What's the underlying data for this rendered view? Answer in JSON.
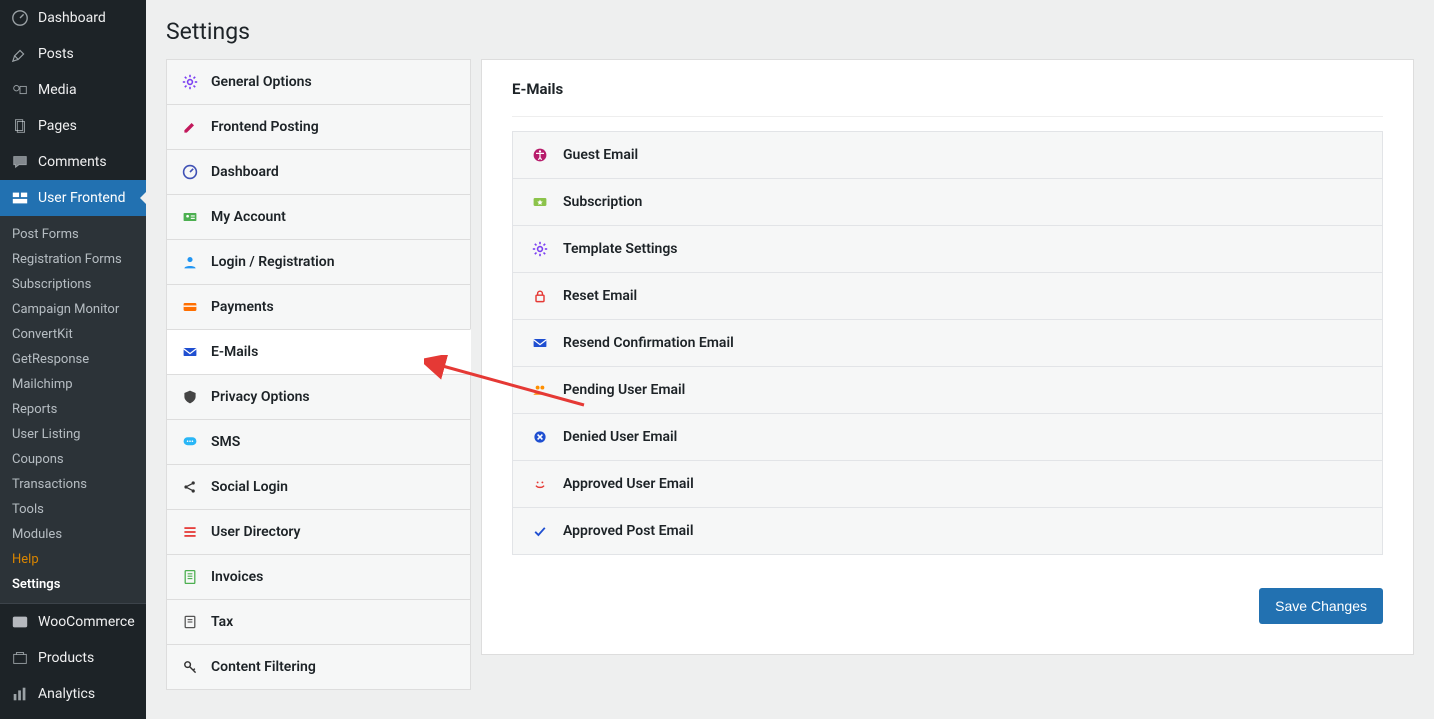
{
  "page_title": "Settings",
  "wp_sidebar": {
    "top": [
      {
        "label": "Dashboard",
        "icon": "dashboard"
      },
      {
        "label": "Posts",
        "icon": "pin"
      },
      {
        "label": "Media",
        "icon": "media"
      },
      {
        "label": "Pages",
        "icon": "page"
      },
      {
        "label": "Comments",
        "icon": "comment"
      }
    ],
    "active": {
      "label": "User Frontend",
      "icon": "uf"
    },
    "sub": [
      "Post Forms",
      "Registration Forms",
      "Subscriptions",
      "Campaign Monitor",
      "ConvertKit",
      "GetResponse",
      "Mailchimp",
      "Reports",
      "User Listing",
      "Coupons",
      "Transactions",
      "Tools",
      "Modules"
    ],
    "sub_help": "Help",
    "sub_settings": "Settings",
    "bottom": [
      {
        "label": "WooCommerce",
        "icon": "woo"
      },
      {
        "label": "Products",
        "icon": "products"
      },
      {
        "label": "Analytics",
        "icon": "analytics"
      }
    ]
  },
  "settings_tabs": [
    {
      "label": "General Options",
      "icon": "gear",
      "color": "#7b3ff2"
    },
    {
      "label": "Frontend Posting",
      "icon": "edit",
      "color": "#c2185b"
    },
    {
      "label": "Dashboard",
      "icon": "dashboard",
      "color": "#3f51b5"
    },
    {
      "label": "My Account",
      "icon": "id-card",
      "color": "#4caf50"
    },
    {
      "label": "Login / Registration",
      "icon": "user",
      "color": "#2196f3"
    },
    {
      "label": "Payments",
      "icon": "card",
      "color": "#ff6f00"
    },
    {
      "label": "E-Mails",
      "icon": "mail",
      "color": "#1f4fd1",
      "active": true
    },
    {
      "label": "Privacy Options",
      "icon": "shield",
      "color": "#444"
    },
    {
      "label": "SMS",
      "icon": "sms",
      "color": "#29b6f6"
    },
    {
      "label": "Social Login",
      "icon": "share",
      "color": "#333"
    },
    {
      "label": "User Directory",
      "icon": "list",
      "color": "#e53935"
    },
    {
      "label": "Invoices",
      "icon": "invoice",
      "color": "#4caf50"
    },
    {
      "label": "Tax",
      "icon": "tax",
      "color": "#555"
    },
    {
      "label": "Content Filtering",
      "icon": "key",
      "color": "#333"
    }
  ],
  "content_title": "E-Mails",
  "rows": [
    {
      "label": "Guest Email",
      "icon": "accessibility",
      "color": "#b71c6b"
    },
    {
      "label": "Subscription",
      "icon": "star-card",
      "color": "#8bc34a"
    },
    {
      "label": "Template Settings",
      "icon": "gear",
      "color": "#7b3ff2"
    },
    {
      "label": "Reset Email",
      "icon": "lock",
      "color": "#e53935"
    },
    {
      "label": "Resend Confirmation Email",
      "icon": "mail",
      "color": "#1f4fd1"
    },
    {
      "label": "Pending User Email",
      "icon": "users",
      "color": "#ff8f00"
    },
    {
      "label": "Denied User Email",
      "icon": "deny",
      "color": "#1f4fd1"
    },
    {
      "label": "Approved User Email",
      "icon": "smile",
      "color": "#e53935"
    },
    {
      "label": "Approved Post Email",
      "icon": "check",
      "color": "#1f4fd1"
    }
  ],
  "save_label": "Save Changes",
  "annotations": {
    "arrow_emails_tab": true,
    "arrow_settings_sub": true
  }
}
